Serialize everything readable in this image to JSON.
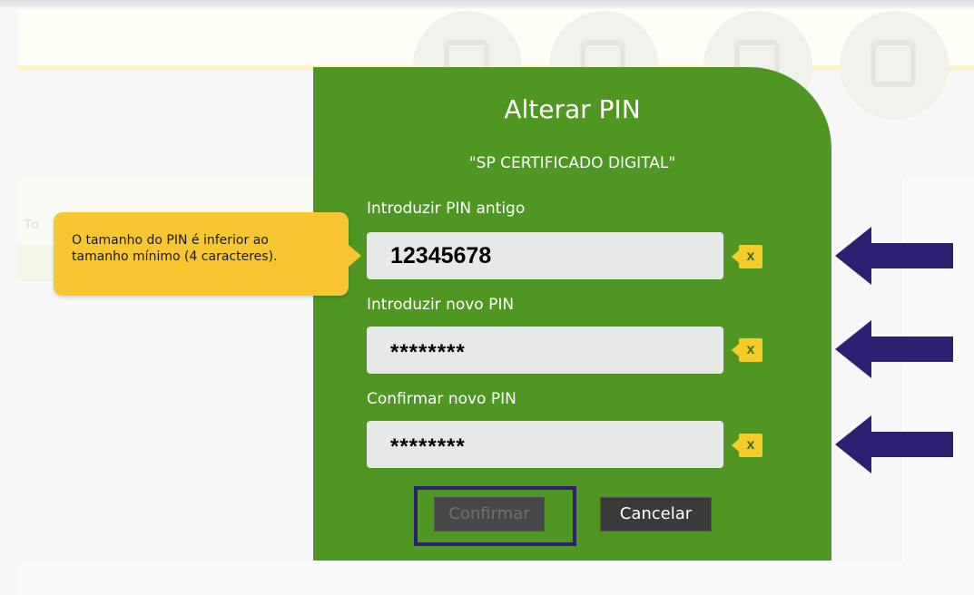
{
  "dialog": {
    "title": "Alterar PIN",
    "subtitle": "\"SP CERTIFICADO DIGITAL\"",
    "fields": [
      {
        "label": "Introduzir PIN antigo",
        "value": "12345678"
      },
      {
        "label": "Introduzir novo PIN",
        "value": "********"
      },
      {
        "label": "Confirmar novo PIN",
        "value": "********"
      }
    ],
    "clear_label": "x",
    "confirm_label": "Confirmar",
    "cancel_label": "Cancelar"
  },
  "tooltip": {
    "message_line1": "O tamanho do PIN é inferior ao",
    "message_line2": "tamanho mínimo (4 caracteres)."
  },
  "background": {
    "faint_text": "To"
  },
  "colors": {
    "dialog_green": "#4f9623",
    "tooltip_yellow": "#f7c630",
    "clear_yellow": "#f5cc2a",
    "annotation_navy": "#2f1f73"
  },
  "icons": [
    "clear-x-icon",
    "annotation-arrow-icon"
  ]
}
